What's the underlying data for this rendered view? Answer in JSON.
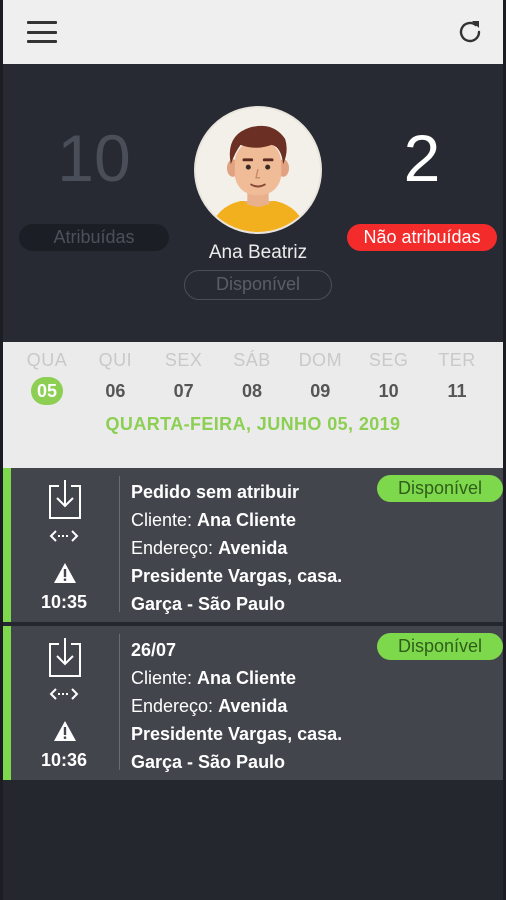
{
  "stats": {
    "assigned_count": "10",
    "assigned_label": "Atribuídas",
    "unassigned_count": "2",
    "unassigned_label": "Não atribuídas",
    "user_name": "Ana Beatriz",
    "user_status": "Disponível"
  },
  "calendar": {
    "days": [
      {
        "name": "QUA",
        "date": "05"
      },
      {
        "name": "QUI",
        "date": "06"
      },
      {
        "name": "SEX",
        "date": "07"
      },
      {
        "name": "SÁB",
        "date": "08"
      },
      {
        "name": "DOM",
        "date": "09"
      },
      {
        "name": "SEG",
        "date": "10"
      },
      {
        "name": "TER",
        "date": "11"
      }
    ],
    "selected_date_label": "QUARTA-FEIRA, JUNHO 05, 2019"
  },
  "orders": [
    {
      "title": "Pedido sem atribuir",
      "status": "Disponível",
      "client_label": "Cliente:",
      "client": "Ana Cliente",
      "address_label": "Endereço:",
      "address_line1": "Avenida",
      "address_line2": "Presidente Vargas, casa.",
      "address_line3": "Garça - São Paulo",
      "time": "10:35"
    },
    {
      "title": "26/07",
      "status": "Disponível",
      "client_label": "Cliente:",
      "client": "Ana Cliente",
      "address_label": "Endereço:",
      "address_line1": "Avenida",
      "address_line2": "Presidente Vargas, casa.",
      "address_line3": "Garça - São Paulo",
      "time": "10:36"
    }
  ],
  "colors": {
    "accent_green": "#8ccf53",
    "badge_green": "#7ed84c",
    "alert_red": "#f42b2b",
    "header_dark": "#272a33",
    "card_dark": "#43454d"
  },
  "icons": [
    "menu-icon",
    "refresh-icon",
    "download-icon",
    "transfer-arrows-icon",
    "warning-icon"
  ]
}
